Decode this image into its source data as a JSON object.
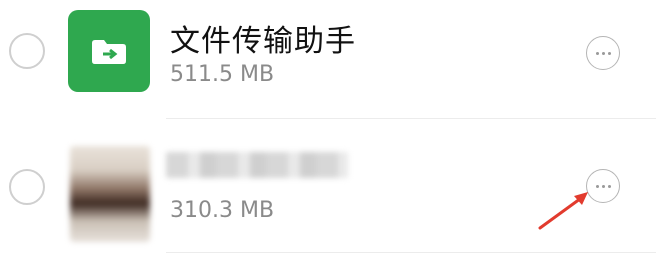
{
  "files": [
    {
      "name": "文件传输助手",
      "size": "511.5 MB",
      "avatar": "file-transfer-folder-icon",
      "avatar_color": "#2fa84f"
    },
    {
      "name": "",
      "size": "310.3 MB",
      "avatar": "blurred-contact-avatar"
    }
  ],
  "annotation": {
    "arrow_color": "#e23b2e"
  }
}
